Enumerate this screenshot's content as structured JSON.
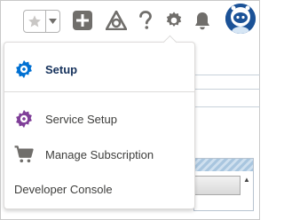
{
  "header": {
    "favorites_icon": "star-icon",
    "favorites_dropdown_icon": "chevron-down-icon",
    "global_actions_icon": "plus-icon",
    "guidance_icon": "trailhead-icon",
    "help_icon": "question-icon",
    "setup_icon": "gear-icon",
    "notifications_icon": "bell-icon",
    "avatar_icon": "astro-avatar"
  },
  "setup_menu": {
    "items": [
      {
        "label": "Setup",
        "icon": "gear-icon",
        "icon_color": "#0070d2"
      },
      {
        "label": "Service Setup",
        "icon": "gear-icon",
        "icon_color": "#7f3e98"
      },
      {
        "label": "Manage Subscription",
        "icon": "cart-icon"
      },
      {
        "label": "Developer Console"
      }
    ]
  },
  "colors": {
    "text": "#3e3e3c",
    "setup_blue": "#0070d2",
    "service_purple": "#7f3e98",
    "icon_gray": "#706e6b"
  }
}
